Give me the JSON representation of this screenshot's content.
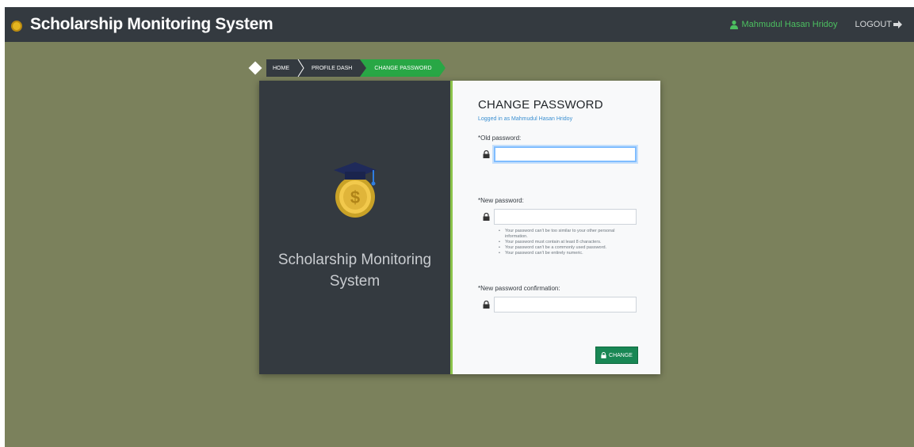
{
  "navbar": {
    "brand": "Scholarship Monitoring System",
    "user": "Mahmudul Hasan Hridoy",
    "logout": "LOGOUT"
  },
  "breadcrumb": {
    "items": [
      "HOME",
      "PROFILE DASH",
      "CHANGE PASSWORD"
    ]
  },
  "left_panel": {
    "title": "Scholarship Monitoring System"
  },
  "form": {
    "title": "CHANGE PASSWORD",
    "logged_as": "Logged in as Mahmudul Hasan Hridoy",
    "old_password_label": "*Old password:",
    "old_password_value": "",
    "new_password_label": "*New password:",
    "new_password_value": "",
    "rules": [
      "Your password can't be too similar to your other personal information.",
      "Your password must contain at least 8 characters.",
      "Your password can't be a commonly used password.",
      "Your password can't be entirely numeric."
    ],
    "confirm_label": "*New password confirmation:",
    "confirm_value": "",
    "submit_label": "CHANGE"
  },
  "colors": {
    "navbar_bg": "#343a40",
    "page_bg": "#7b815c",
    "accent_green": "#28a745",
    "user_green": "#4cc060",
    "link_blue": "#3a8fd1"
  }
}
